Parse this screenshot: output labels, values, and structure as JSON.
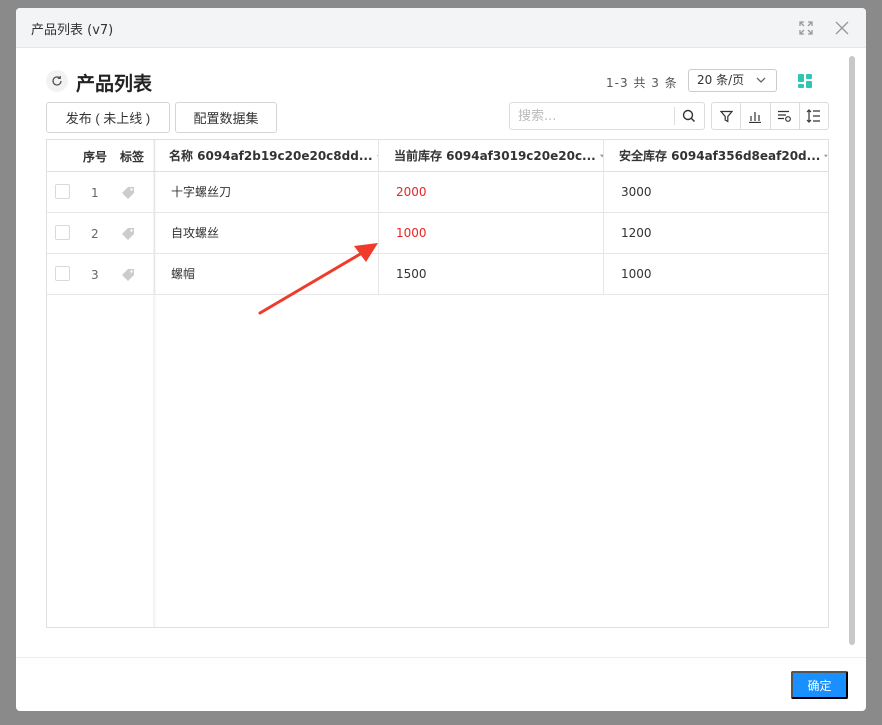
{
  "window": {
    "title": "产品列表 (v7)"
  },
  "page": {
    "title": "产品列表"
  },
  "pager": {
    "range": "1-3",
    "total_label": "共",
    "total": "3",
    "unit": "条",
    "page_size": "20 条/页"
  },
  "toolbar": {
    "publish_label": "发布 ( 未上线 )",
    "dataset_label": "配置数据集",
    "search_placeholder": "搜索..."
  },
  "table": {
    "columns": {
      "seq": "序号",
      "tag": "标签",
      "name": "名称 6094af2b19c20e20c8dd...",
      "stock": "当前库存 6094af3019c20e20c...",
      "safe": "安全库存 6094af356d8eaf20d..."
    },
    "rows": [
      {
        "seq": "1",
        "name": "十字螺丝刀",
        "stock": "2000",
        "safe": "3000"
      },
      {
        "seq": "2",
        "name": "自攻螺丝",
        "stock": "1000",
        "safe": "1200"
      },
      {
        "seq": "3",
        "name": "螺帽",
        "stock": "1500",
        "safe": "1000"
      }
    ]
  },
  "footer": {
    "ok_label": "确定"
  },
  "colors": {
    "accent": "#1890ff",
    "warning_text": "#e62626",
    "grid_icon": "#2ec7b5",
    "annotation_arrow": "#f03a2a"
  }
}
